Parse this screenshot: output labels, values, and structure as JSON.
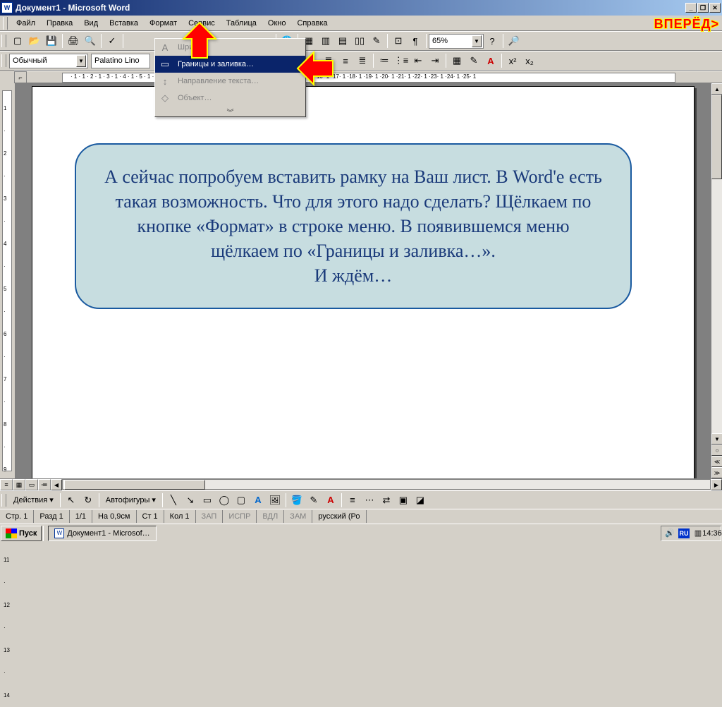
{
  "window": {
    "title": "Документ1 - Microsoft Word",
    "app_icon": "W"
  },
  "menubar": {
    "items": [
      "Файл",
      "Правка",
      "Вид",
      "Вставка",
      "Формат",
      "Сервис",
      "Таблица",
      "Окно",
      "Справка"
    ],
    "forward": "ВПЕРЁД>"
  },
  "toolbar1": {
    "zoom": "65%"
  },
  "toolbar2": {
    "style": "Обычный",
    "font": "Palatino Lino"
  },
  "format_menu": {
    "items": [
      {
        "icon": "A",
        "label": "Шри",
        "enabled": false
      },
      {
        "icon": "▭",
        "label": "Границы и заливка…",
        "enabled": true,
        "highlighted": true
      },
      {
        "icon": "↕",
        "label": "Направление текста…",
        "enabled": false
      },
      {
        "icon": "◇",
        "label": "Объект…",
        "enabled": false
      }
    ]
  },
  "callout_text": "А сейчас попробуем вставить рамку на Ваш лист. В Word'е есть такая возможность. Что для этого надо сделать? Щёлкаем по кнопке «Формат» в строке меню. В появившемся меню щёлкаем по «Границы и заливка…».\nИ ждём…",
  "drawing": {
    "actions": "Действия",
    "autoshapes": "Автофигуры"
  },
  "statusbar": {
    "page": "Стр. 1",
    "section": "Разд 1",
    "pageof": "1/1",
    "at": "На 0,9см",
    "line": "Ст 1",
    "col": "Кол 1",
    "rec": "ЗАП",
    "trk": "ИСПР",
    "ext": "ВДЛ",
    "ovr": "ЗАМ",
    "lang": "русский (Ро"
  },
  "taskbar": {
    "start": "Пуск",
    "task1": "Документ1 - Microsof…",
    "lang": "RU",
    "time": "14:36"
  }
}
